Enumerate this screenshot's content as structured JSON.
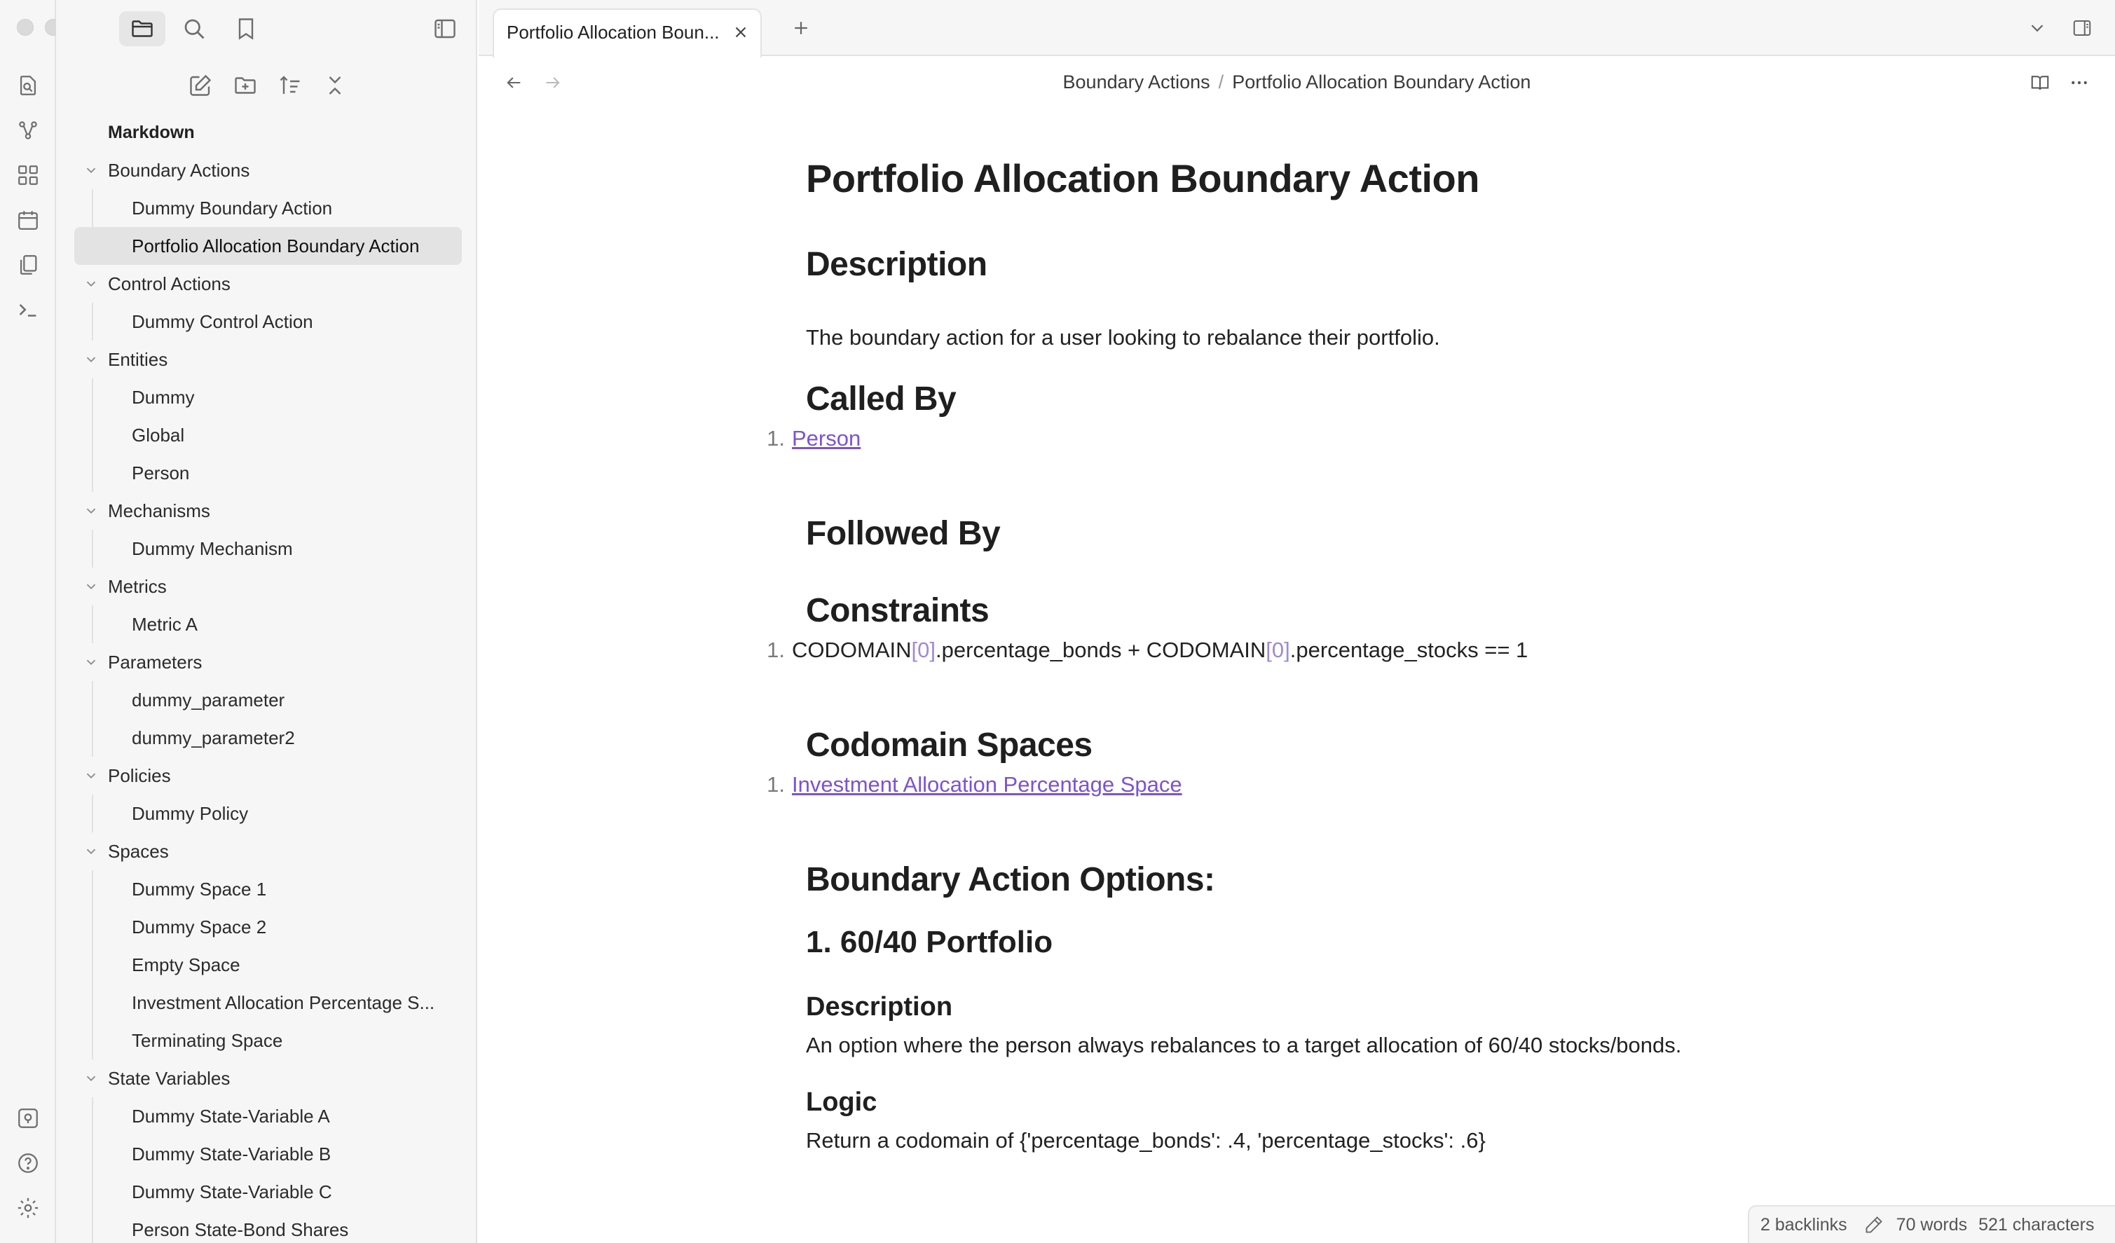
{
  "window": {
    "traffic_lights": [
      "close",
      "minimize",
      "zoom"
    ]
  },
  "ribbon": {
    "top_icons": [
      "quick-switcher-icon",
      "graph-view-icon",
      "canvas-icon",
      "daily-notes-icon",
      "templates-icon",
      "command-palette-icon"
    ],
    "bottom_icons": [
      "open-vault-icon",
      "help-icon",
      "settings-icon"
    ]
  },
  "sidebar": {
    "top_tabs": [
      "files-icon",
      "search-icon",
      "bookmarks-icon"
    ],
    "actions": [
      "new-note-icon",
      "new-folder-icon",
      "sort-icon",
      "collapse-all-icon"
    ],
    "root": "Markdown",
    "folders": [
      {
        "label": "Boundary Actions",
        "files": [
          "Dummy Boundary Action",
          "Portfolio Allocation Boundary Action"
        ]
      },
      {
        "label": "Control Actions",
        "files": [
          "Dummy Control Action"
        ]
      },
      {
        "label": "Entities",
        "files": [
          "Dummy",
          "Global",
          "Person"
        ]
      },
      {
        "label": "Mechanisms",
        "files": [
          "Dummy Mechanism"
        ]
      },
      {
        "label": "Metrics",
        "files": [
          "Metric A"
        ]
      },
      {
        "label": "Parameters",
        "files": [
          "dummy_parameter",
          "dummy_parameter2"
        ]
      },
      {
        "label": "Policies",
        "files": [
          "Dummy Policy"
        ]
      },
      {
        "label": "Spaces",
        "files": [
          "Dummy Space 1",
          "Dummy Space 2",
          "Empty Space",
          "Investment Allocation Percentage S...",
          "Terminating Space"
        ]
      },
      {
        "label": "State Variables",
        "files": [
          "Dummy State-Variable A",
          "Dummy State-Variable B",
          "Dummy State-Variable C",
          "Person State-Bond Shares"
        ]
      }
    ],
    "active_file": "Portfolio Allocation Boundary Action"
  },
  "tabs": {
    "active_title": "Portfolio Allocation Boun..."
  },
  "breadcrumb": {
    "folder": "Boundary Actions",
    "separator": "/",
    "note": "Portfolio Allocation Boundary Action"
  },
  "document": {
    "title": "Portfolio Allocation Boundary Action",
    "description_heading": "Description",
    "description_text": "The boundary action for a user looking to rebalance their portfolio.",
    "called_by_heading": "Called By",
    "called_by": [
      {
        "num": "1.",
        "text": "Person"
      }
    ],
    "followed_by_heading": "Followed By",
    "constraints_heading": "Constraints",
    "constraint": {
      "num": "1.",
      "part1": "CODOMAIN",
      "bracket_open": "[",
      "index": "0",
      "bracket_close": "]",
      "part2": ".percentage_bonds + CODOMAIN",
      "part3": ".percentage_stocks == 1"
    },
    "codomain_heading": "Codomain Spaces",
    "codomain": [
      {
        "num": "1.",
        "text": "Investment Allocation Percentage Space"
      }
    ],
    "options_heading": "Boundary Action Options:",
    "option_title": "1. 60/40 Portfolio",
    "option_description_heading": "Description",
    "option_description_text": "An option where the person always rebalances to a target allocation of 60/40 stocks/bonds.",
    "logic_heading": "Logic",
    "logic_text": "Return a codomain of {'percentage_bonds': .4, 'percentage_stocks': .6}"
  },
  "status": {
    "backlinks": "2 backlinks",
    "words": "70 words",
    "characters": "521 characters"
  },
  "colors": {
    "link": "#7b52d6",
    "sidebar_bg": "#f6f6f6",
    "active_file_bg": "#e3e3e3"
  }
}
